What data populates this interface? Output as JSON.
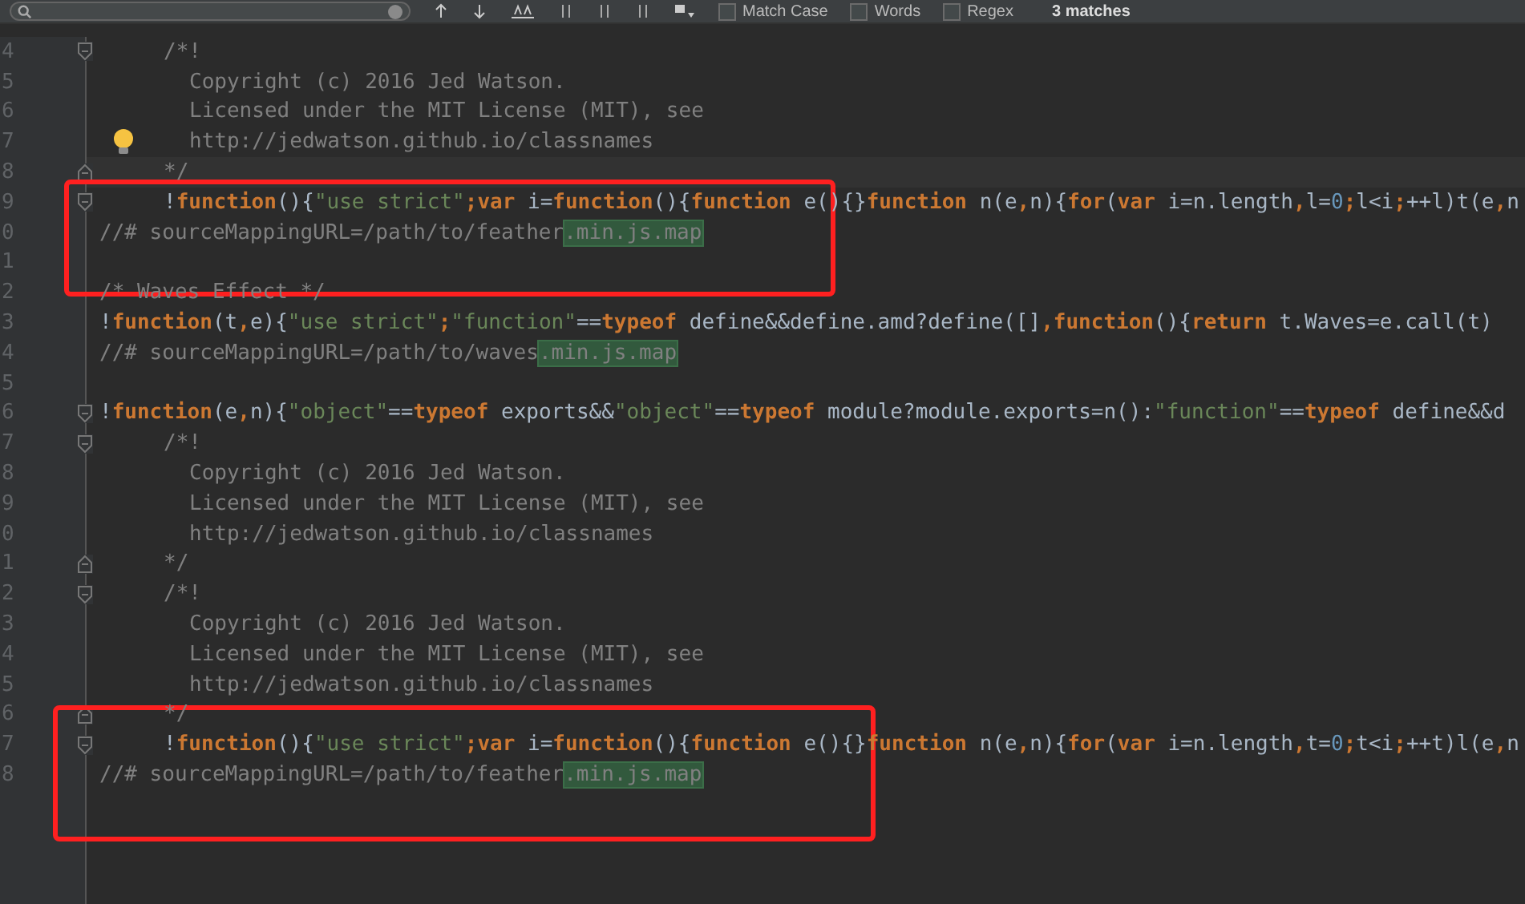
{
  "find_bar": {
    "options": [
      {
        "label": "Match Case",
        "checked": false
      },
      {
        "label": "Words",
        "checked": false
      },
      {
        "label": "Regex",
        "checked": false
      }
    ],
    "match_count": "3 matches"
  },
  "editor": {
    "lines": [
      {
        "number": "4",
        "fold_open": true,
        "fold_close": false,
        "bulb": false,
        "current": false,
        "kind": "inner",
        "tokens": [
          {
            "t": "/*!",
            "kind": "comment"
          }
        ]
      },
      {
        "number": "5",
        "fold_open": false,
        "fold_close": false,
        "bulb": false,
        "current": false,
        "kind": "comment-text",
        "tokens": [
          {
            "t": "Copyright (c) 2016 Jed Watson.",
            "kind": "comment"
          }
        ]
      },
      {
        "number": "6",
        "fold_open": false,
        "fold_close": false,
        "bulb": false,
        "current": false,
        "kind": "comment-text",
        "tokens": [
          {
            "t": "Licensed under the MIT License (MIT), see",
            "kind": "comment"
          }
        ]
      },
      {
        "number": "7",
        "fold_open": false,
        "fold_close": false,
        "bulb": true,
        "current": false,
        "kind": "comment-text",
        "tokens": [
          {
            "t": "http://jedwatson.github.io/classnames",
            "kind": "comment"
          }
        ]
      },
      {
        "number": "8",
        "fold_open": false,
        "fold_close": true,
        "bulb": false,
        "current": true,
        "kind": "inner",
        "tokens": [
          {
            "t": "*/",
            "kind": "comment"
          }
        ]
      },
      {
        "number": "9",
        "fold_open": true,
        "fold_close": false,
        "bulb": false,
        "current": false,
        "kind": "inner",
        "tokens": [
          {
            "t": "!",
            "kind": "plain"
          },
          {
            "t": "function",
            "kind": "keyword"
          },
          {
            "t": "(){",
            "kind": "plain"
          },
          {
            "t": "\"use strict\"",
            "kind": "string"
          },
          {
            "t": ";",
            "kind": "keyword"
          },
          {
            "t": "var ",
            "kind": "keyword"
          },
          {
            "t": "i=",
            "kind": "plain"
          },
          {
            "t": "function",
            "kind": "keyword"
          },
          {
            "t": "(){",
            "kind": "plain"
          },
          {
            "t": "function ",
            "kind": "keyword"
          },
          {
            "t": "e(){}",
            "kind": "plain"
          },
          {
            "t": "function ",
            "kind": "keyword"
          },
          {
            "t": "n(e",
            "kind": "plain"
          },
          {
            "t": ",",
            "kind": "keyword"
          },
          {
            "t": "n){",
            "kind": "plain"
          },
          {
            "t": "for",
            "kind": "keyword"
          },
          {
            "t": "(",
            "kind": "plain"
          },
          {
            "t": "var ",
            "kind": "keyword"
          },
          {
            "t": "i=n.length",
            "kind": "plain"
          },
          {
            "t": ",",
            "kind": "keyword"
          },
          {
            "t": "l=",
            "kind": "plain"
          },
          {
            "t": "0",
            "kind": "number"
          },
          {
            "t": ";",
            "kind": "keyword"
          },
          {
            "t": "l<i",
            "kind": "plain"
          },
          {
            "t": ";",
            "kind": "keyword"
          },
          {
            "t": "++l)t(e",
            "kind": "plain"
          },
          {
            "t": ",",
            "kind": "keyword"
          },
          {
            "t": "n",
            "kind": "plain"
          }
        ]
      },
      {
        "number": "0",
        "fold_open": false,
        "fold_close": false,
        "bulb": false,
        "current": false,
        "tokens": [
          {
            "t": "//# sourceMappingURL=/path/to/feather",
            "kind": "comment"
          },
          {
            "t": ".min.js.map",
            "kind": "match"
          }
        ]
      },
      {
        "number": "1",
        "fold_open": false,
        "fold_close": false,
        "bulb": false,
        "current": false
      },
      {
        "number": "2",
        "fold_open": false,
        "fold_close": false,
        "bulb": false,
        "current": false,
        "tokens": [
          {
            "t": "/* Waves Effect */",
            "kind": "comment"
          }
        ]
      },
      {
        "number": "3",
        "fold_open": false,
        "fold_close": false,
        "bulb": false,
        "current": false,
        "tokens": [
          {
            "t": "!",
            "kind": "plain"
          },
          {
            "t": "function",
            "kind": "keyword"
          },
          {
            "t": "(t",
            "kind": "plain"
          },
          {
            "t": ",",
            "kind": "keyword"
          },
          {
            "t": "e){",
            "kind": "plain"
          },
          {
            "t": "\"use strict\"",
            "kind": "string"
          },
          {
            "t": ";",
            "kind": "keyword"
          },
          {
            "t": "\"function\"",
            "kind": "string"
          },
          {
            "t": "==",
            "kind": "plain"
          },
          {
            "t": "typeof ",
            "kind": "keyword"
          },
          {
            "t": "define&&define.amd?define([]",
            "kind": "plain"
          },
          {
            "t": ",",
            "kind": "keyword"
          },
          {
            "t": "function",
            "kind": "keyword"
          },
          {
            "t": "(){",
            "kind": "plain"
          },
          {
            "t": "return ",
            "kind": "keyword"
          },
          {
            "t": "t.Waves=e.call(t)",
            "kind": "plain"
          }
        ]
      },
      {
        "number": "4",
        "fold_open": false,
        "fold_close": false,
        "bulb": false,
        "current": false,
        "tokens": [
          {
            "t": "//# sourceMappingURL=/path/to/waves",
            "kind": "comment"
          },
          {
            "t": ".min.js.map",
            "kind": "match"
          }
        ]
      },
      {
        "number": "5",
        "fold_open": false,
        "fold_close": false,
        "bulb": false,
        "current": false
      },
      {
        "number": "6",
        "fold_open": true,
        "fold_close": false,
        "bulb": false,
        "current": false,
        "tokens": [
          {
            "t": "!",
            "kind": "plain"
          },
          {
            "t": "function",
            "kind": "keyword"
          },
          {
            "t": "(e",
            "kind": "plain"
          },
          {
            "t": ",",
            "kind": "keyword"
          },
          {
            "t": "n){",
            "kind": "plain"
          },
          {
            "t": "\"object\"",
            "kind": "string"
          },
          {
            "t": "==",
            "kind": "plain"
          },
          {
            "t": "typeof ",
            "kind": "keyword"
          },
          {
            "t": "exports&&",
            "kind": "plain"
          },
          {
            "t": "\"object\"",
            "kind": "string"
          },
          {
            "t": "==",
            "kind": "plain"
          },
          {
            "t": "typeof ",
            "kind": "keyword"
          },
          {
            "t": "module?module.exports=n():",
            "kind": "plain"
          },
          {
            "t": "\"function\"",
            "kind": "string"
          },
          {
            "t": "==",
            "kind": "plain"
          },
          {
            "t": "typeof ",
            "kind": "keyword"
          },
          {
            "t": "define&&d",
            "kind": "plain"
          }
        ]
      },
      {
        "number": "7",
        "fold_open": true,
        "fold_close": false,
        "bulb": false,
        "current": false,
        "kind": "inner",
        "tokens": [
          {
            "t": "/*!",
            "kind": "comment"
          }
        ]
      },
      {
        "number": "8",
        "fold_open": false,
        "fold_close": false,
        "bulb": false,
        "current": false,
        "kind": "comment-text",
        "tokens": [
          {
            "t": "Copyright (c) 2016 Jed Watson.",
            "kind": "comment"
          }
        ]
      },
      {
        "number": "9",
        "fold_open": false,
        "fold_close": false,
        "bulb": false,
        "current": false,
        "kind": "comment-text",
        "tokens": [
          {
            "t": "Licensed under the MIT License (MIT), see",
            "kind": "comment"
          }
        ]
      },
      {
        "number": "0",
        "fold_open": false,
        "fold_close": false,
        "bulb": false,
        "current": false,
        "kind": "comment-text",
        "tokens": [
          {
            "t": "http://jedwatson.github.io/classnames",
            "kind": "comment"
          }
        ]
      },
      {
        "number": "1",
        "fold_open": false,
        "fold_close": true,
        "bulb": false,
        "current": false,
        "kind": "inner",
        "tokens": [
          {
            "t": "*/",
            "kind": "comment"
          }
        ]
      },
      {
        "number": "2",
        "fold_open": true,
        "fold_close": false,
        "bulb": false,
        "current": false,
        "kind": "inner",
        "tokens": [
          {
            "t": "/*!",
            "kind": "comment"
          }
        ]
      },
      {
        "number": "3",
        "fold_open": false,
        "fold_close": false,
        "bulb": false,
        "current": false,
        "kind": "comment-text",
        "tokens": [
          {
            "t": "Copyright (c) 2016 Jed Watson.",
            "kind": "comment"
          }
        ]
      },
      {
        "number": "4",
        "fold_open": false,
        "fold_close": false,
        "bulb": false,
        "current": false,
        "kind": "comment-text",
        "tokens": [
          {
            "t": "Licensed under the MIT License (MIT), see",
            "kind": "comment"
          }
        ]
      },
      {
        "number": "5",
        "fold_open": false,
        "fold_close": false,
        "bulb": false,
        "current": false,
        "kind": "comment-text",
        "tokens": [
          {
            "t": "http://jedwatson.github.io/classnames",
            "kind": "comment"
          }
        ]
      },
      {
        "number": "6",
        "fold_open": false,
        "fold_close": true,
        "bulb": false,
        "current": false,
        "kind": "inner",
        "tokens": [
          {
            "t": "*/",
            "kind": "comment"
          }
        ]
      },
      {
        "number": "7",
        "fold_open": true,
        "fold_close": false,
        "bulb": false,
        "current": false,
        "kind": "inner",
        "tokens": [
          {
            "t": "!",
            "kind": "plain"
          },
          {
            "t": "function",
            "kind": "keyword"
          },
          {
            "t": "(){",
            "kind": "plain"
          },
          {
            "t": "\"use strict\"",
            "kind": "string"
          },
          {
            "t": ";",
            "kind": "keyword"
          },
          {
            "t": "var ",
            "kind": "keyword"
          },
          {
            "t": "i=",
            "kind": "plain"
          },
          {
            "t": "function",
            "kind": "keyword"
          },
          {
            "t": "(){",
            "kind": "plain"
          },
          {
            "t": "function ",
            "kind": "keyword"
          },
          {
            "t": "e(){}",
            "kind": "plain"
          },
          {
            "t": "function ",
            "kind": "keyword"
          },
          {
            "t": "n(e",
            "kind": "plain"
          },
          {
            "t": ",",
            "kind": "keyword"
          },
          {
            "t": "n){",
            "kind": "plain"
          },
          {
            "t": "for",
            "kind": "keyword"
          },
          {
            "t": "(",
            "kind": "plain"
          },
          {
            "t": "var ",
            "kind": "keyword"
          },
          {
            "t": "i=n.length",
            "kind": "plain"
          },
          {
            "t": ",",
            "kind": "keyword"
          },
          {
            "t": "t=",
            "kind": "plain"
          },
          {
            "t": "0",
            "kind": "number"
          },
          {
            "t": ";",
            "kind": "keyword"
          },
          {
            "t": "t<i",
            "kind": "plain"
          },
          {
            "t": ";",
            "kind": "keyword"
          },
          {
            "t": "++t)l(e",
            "kind": "plain"
          },
          {
            "t": ",",
            "kind": "keyword"
          },
          {
            "t": "n",
            "kind": "plain"
          }
        ]
      },
      {
        "number": "8",
        "fold_open": false,
        "fold_close": false,
        "bulb": false,
        "current": false,
        "tokens": [
          {
            "t": "//# sourceMappingURL=/path/to/feather",
            "kind": "comment"
          },
          {
            "t": ".min.js.map",
            "kind": "match"
          }
        ]
      }
    ]
  },
  "annotations": [
    {
      "kind": "red-box"
    },
    {
      "kind": "red-box"
    }
  ]
}
